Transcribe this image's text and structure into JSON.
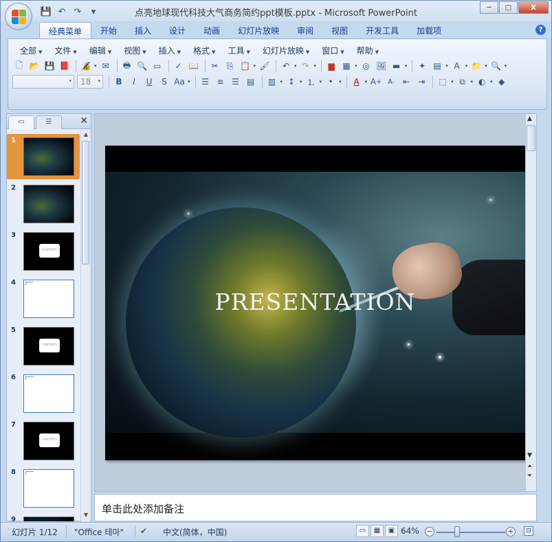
{
  "window": {
    "title": "点亮地球现代科技大气商务简约ppt模板.pptx - Microsoft PowerPoint",
    "controls": {
      "minimize": "─",
      "maximize": "□",
      "close": "X"
    }
  },
  "quick_access": {
    "save_icon": "💾",
    "undo_icon": "↶",
    "redo_icon": "↷",
    "more": "▾"
  },
  "ribbon": {
    "tabs": [
      "经典菜单",
      "开始",
      "插入",
      "设计",
      "动画",
      "幻灯片放映",
      "审阅",
      "视图",
      "开发工具",
      "加载项"
    ],
    "active_tab": 0,
    "help": "?",
    "menus": [
      "全部",
      "文件",
      "编辑",
      "视图",
      "插入",
      "格式",
      "工具",
      "幻灯片放映",
      "窗口",
      "帮助"
    ],
    "font_name": "",
    "font_size": "18"
  },
  "thumbnails": [
    {
      "num": "1",
      "style": "dark-title"
    },
    {
      "num": "2",
      "style": "dark-list"
    },
    {
      "num": "3",
      "style": "contents"
    },
    {
      "num": "4",
      "style": "white"
    },
    {
      "num": "5",
      "style": "contents"
    },
    {
      "num": "6",
      "style": "white"
    },
    {
      "num": "7",
      "style": "contents"
    },
    {
      "num": "8",
      "style": "white"
    },
    {
      "num": "9",
      "style": "dark-title"
    }
  ],
  "thumb_label": "CONTENTS",
  "slide": {
    "title": "PRESENTATION"
  },
  "notes": {
    "placeholder": "单击此处添加备注"
  },
  "status": {
    "slide_counter": "幻灯片 1/12",
    "theme": "\"Office 테마\"",
    "language": "中文(简体，中国)",
    "zoom": "64%"
  },
  "colors": {
    "selected_thumb": "#e5953c",
    "ribbon_text": "#15428b"
  }
}
